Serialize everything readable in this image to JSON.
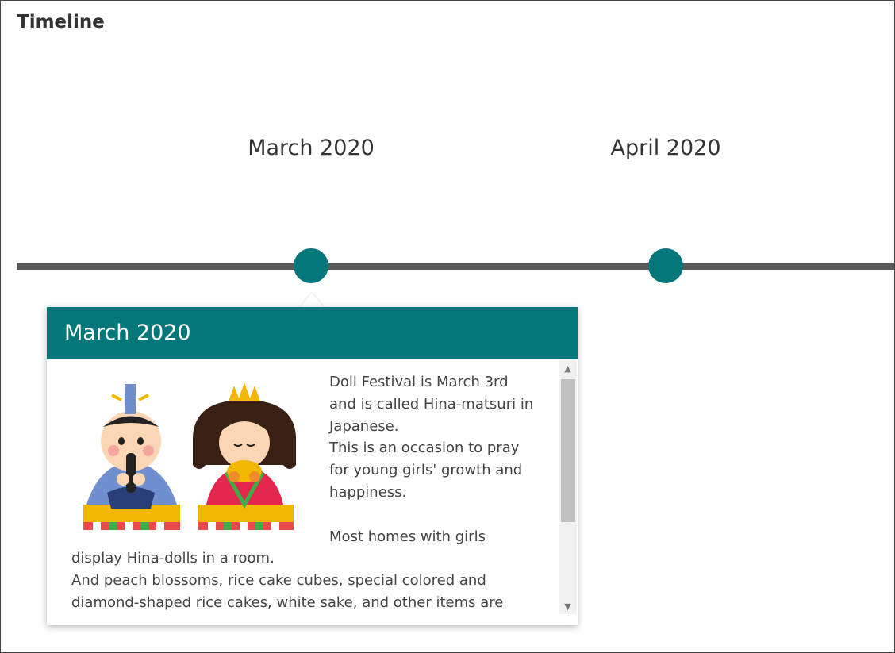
{
  "title": "Timeline",
  "timeline": {
    "markers": [
      {
        "label": "March 2020"
      },
      {
        "label": "April 2020"
      }
    ]
  },
  "popup": {
    "header": "March 2020",
    "image_icon": "hina-dolls-illustration",
    "paragraphs": [
      "Doll Festival is March 3rd and is called Hina-matsuri in Japanese.",
      "This is an occasion to pray for young girls' growth and happiness.",
      "",
      "Most homes with girls display Hina-dolls in a room.",
      "And peach blossoms, rice cake cubes, special colored and diamond-shaped rice cakes, white sake, and other items are"
    ]
  },
  "colors": {
    "accent": "#04777b",
    "line": "#595959"
  }
}
